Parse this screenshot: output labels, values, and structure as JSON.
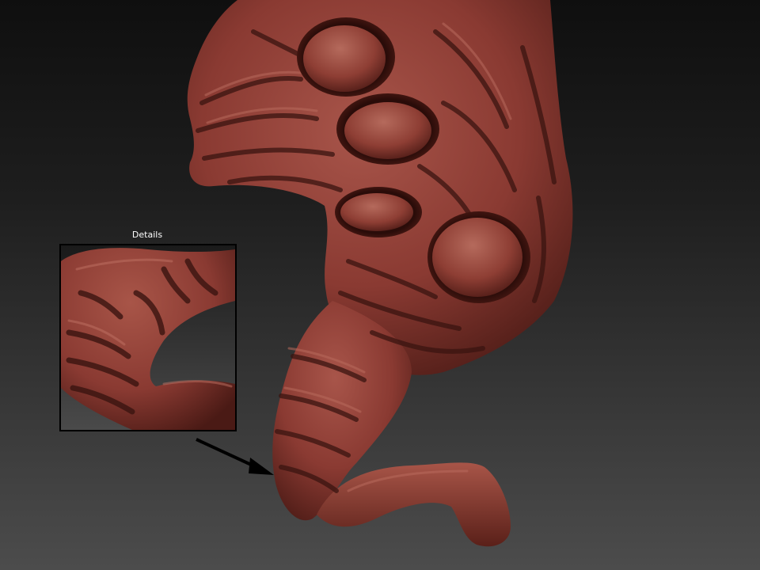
{
  "viewport": {
    "background_top": "#0e0e0e",
    "background_bottom": "#4a4a4a",
    "model": {
      "name": "creature-sculpt",
      "material_color": "#8a3a32",
      "highlight_color": "#b86a5c",
      "shadow_color": "#3a1410"
    }
  },
  "details": {
    "title": "Details",
    "border_color": "#000000"
  },
  "annotation": {
    "arrow_color": "#000000"
  }
}
